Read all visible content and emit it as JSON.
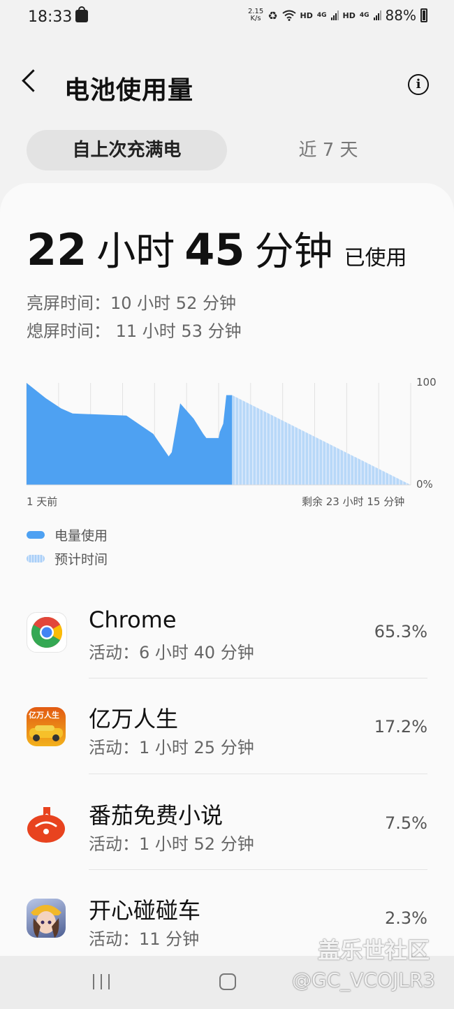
{
  "status_bar": {
    "time": "18:33",
    "speed_value": "2.15",
    "speed_unit": "K/s",
    "hd1": "HD",
    "net1": "4G",
    "hd2": "HD",
    "net2": "4G",
    "battery": "88%"
  },
  "header": {
    "title": "电池使用量"
  },
  "tabs": {
    "active": "自上次充满电",
    "other": "近 7 天"
  },
  "summary": {
    "hours": "22",
    "hours_unit": "小时",
    "minutes": "45",
    "minutes_unit": "分钟",
    "used_label": "已使用",
    "screen_on": "亮屏时间：10 小时 52 分钟",
    "screen_off": "熄屏时间： 11 小时 53 分钟"
  },
  "chart_data": {
    "type": "area",
    "y_max_label": "100",
    "y_min_label": "0%",
    "x_start_label": "1 天前",
    "x_end_label": "剩余 23 小时 15 分钟",
    "ylim": [
      0,
      100
    ],
    "actual_color": "#4ea1f2",
    "projected_color": "#b8d8f8",
    "actual_series": {
      "x": [
        0,
        0.05,
        0.09,
        0.12,
        0.26,
        0.33,
        0.37,
        0.378,
        0.4,
        0.435,
        0.46,
        0.468,
        0.5,
        0.503,
        0.512,
        0.52,
        0.535
      ],
      "values": [
        100,
        85,
        75,
        70,
        68,
        50,
        28,
        32,
        80,
        65,
        50,
        46,
        46,
        52,
        60,
        88,
        88
      ]
    },
    "projected_series": {
      "x": [
        0.535,
        1.0
      ],
      "values": [
        88,
        0
      ]
    }
  },
  "legend": {
    "actual": "电量使用",
    "projected": "预计时间"
  },
  "apps": [
    {
      "name": "Chrome",
      "activity": "活动：6 小时 40 分钟",
      "percent": "65.3%"
    },
    {
      "name": "亿万人生",
      "activity": "活动：1 小时 25 分钟",
      "percent": "17.2%",
      "icon_text": "亿万人生"
    },
    {
      "name": "番茄免费小说",
      "activity": "活动：1 小时 52 分钟",
      "percent": "7.5%"
    },
    {
      "name": "开心碰碰车",
      "activity": "活动：11 分钟",
      "percent": "2.3%"
    }
  ],
  "watermark": {
    "line1": "盖乐世社区",
    "line2": "@GC_VCOJLR3"
  }
}
